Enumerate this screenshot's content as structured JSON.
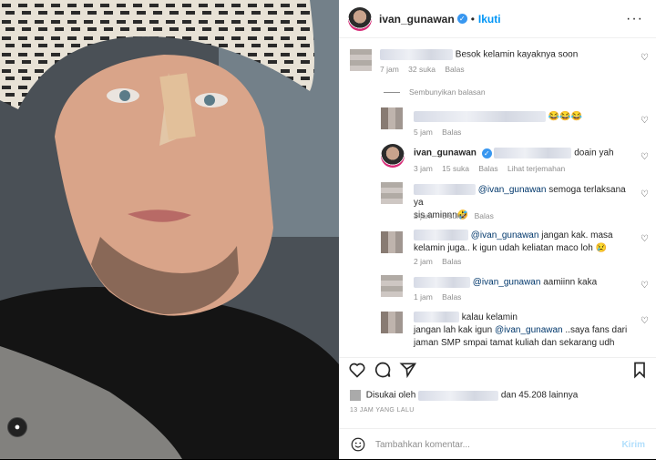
{
  "header": {
    "username": "ivan_gunawan",
    "separator": "•",
    "follow_label": "Ikuti",
    "more_label": "···"
  },
  "comments": [
    {
      "text": "Besok kelamin kayaknya soon",
      "time": "7 jam",
      "likes": "32 suka",
      "reply": "Balas"
    },
    {
      "hide_replies": "Sembunyikan balasan"
    },
    {
      "text": "😂😂😂",
      "time": "5 jam",
      "reply": "Balas"
    },
    {
      "username": "ivan_gunawan",
      "text": "doain yah",
      "time": "3 jam",
      "likes": "15 suka",
      "reply": "Balas",
      "translate": "Lihat terjemahan"
    },
    {
      "mention": "@ivan_gunawan",
      "text_1": "semoga terlaksana ya",
      "text_2": "sis aminnn🤣",
      "time": "2 jam",
      "likes": "3 suka",
      "reply": "Balas"
    },
    {
      "mention": "@ivan_gunawan",
      "text_1": "jangan kak. masa",
      "text_2": "kelamin juga.. k igun udah keliatan maco loh 😢",
      "time": "2 jam",
      "reply": "Balas"
    },
    {
      "mention": "@ivan_gunawan",
      "text": "aamiinn kaka",
      "time": "1 jam",
      "reply": "Balas"
    },
    {
      "text_1": "kalau kelamin",
      "text_2a": "jangan lah kak igun",
      "mention": "@ivan_gunawan",
      "text_2b": "..saya fans dari",
      "text_3": "jaman SMP smpai tamat kuliah dan sekarang udh"
    }
  ],
  "likes": {
    "prefix": "Disukai oleh",
    "suffix": "dan 45.208 lainnya"
  },
  "timestamp": "13 JAM YANG LALU",
  "add_comment": {
    "placeholder": "Tambahkan komentar...",
    "post_label": "Kirim"
  }
}
